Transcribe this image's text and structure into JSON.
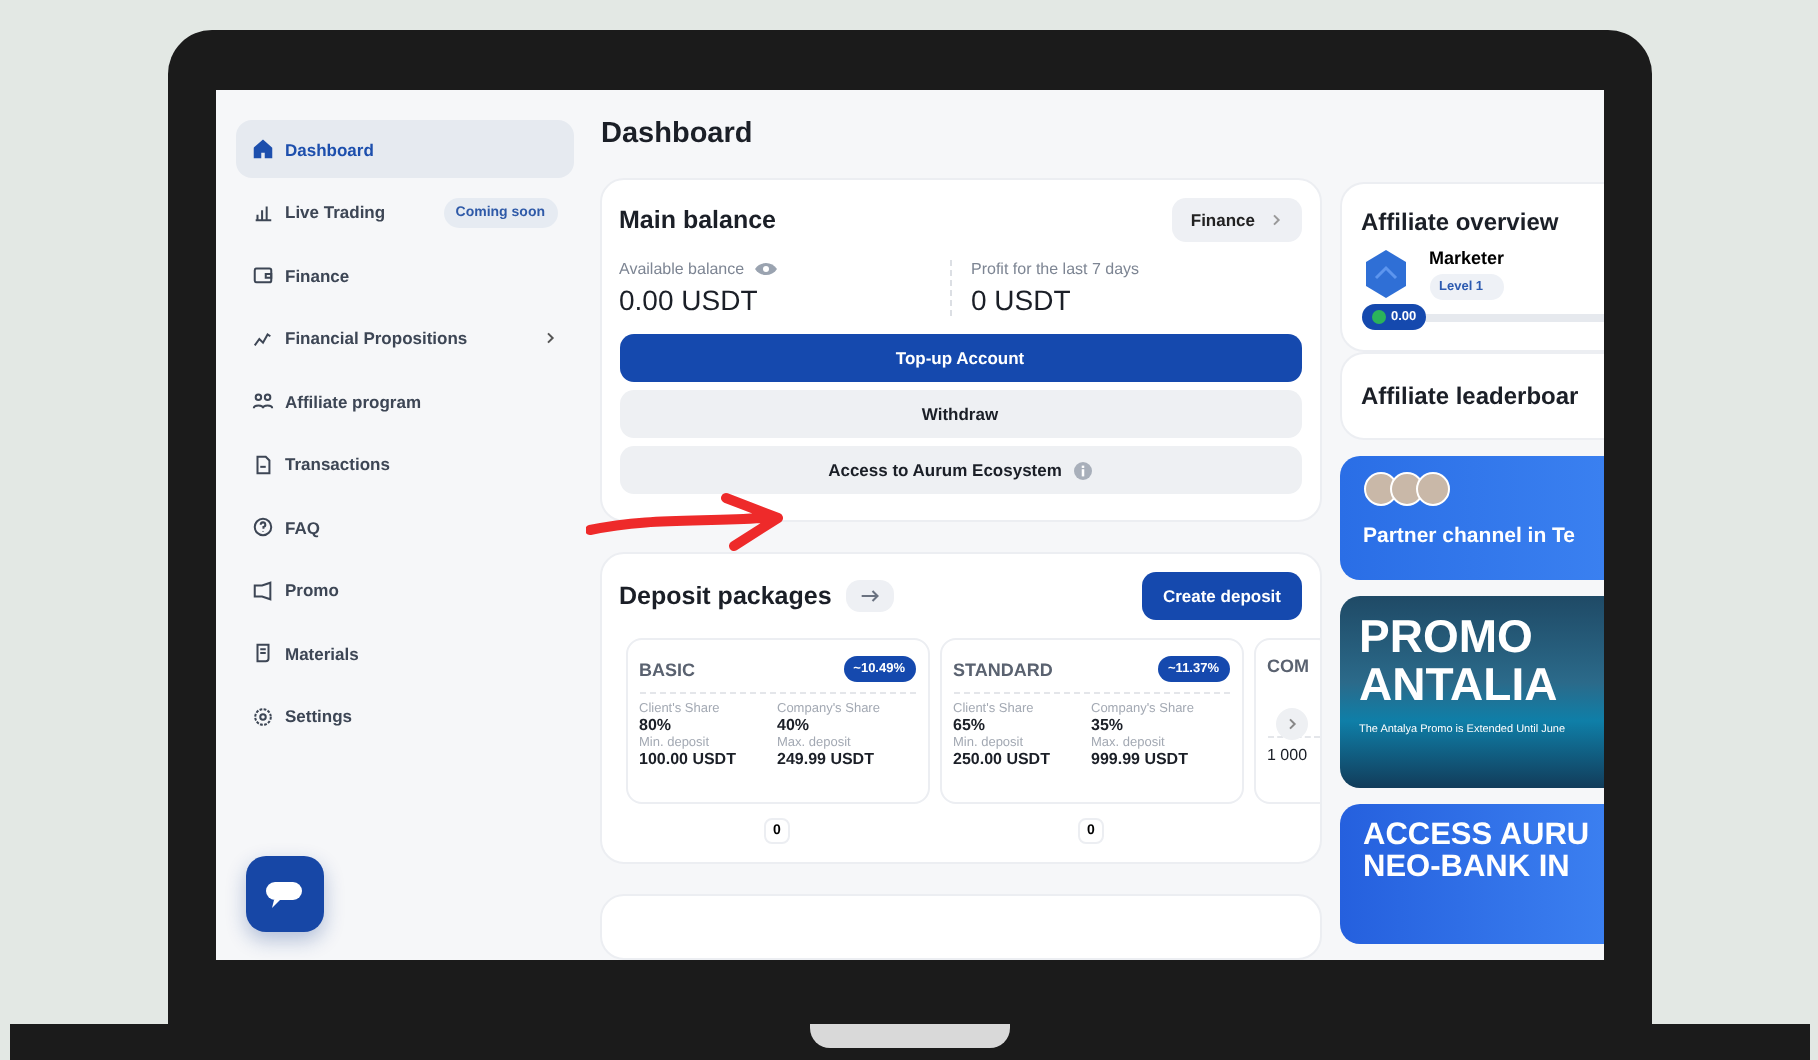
{
  "page": {
    "title": "Dashboard"
  },
  "sidebar": {
    "items": [
      {
        "label": "Dashboard",
        "selected": true,
        "submenu": false
      },
      {
        "label": "Live Trading",
        "selected": false,
        "submenu": false,
        "badge": "Coming soon"
      },
      {
        "label": "Finance",
        "selected": false,
        "submenu": false
      },
      {
        "label": "Financial Propositions",
        "selected": false,
        "submenu": true
      },
      {
        "label": "Affiliate program",
        "selected": false,
        "submenu": false
      },
      {
        "label": "Transactions",
        "selected": false,
        "submenu": false
      },
      {
        "label": "FAQ",
        "selected": false,
        "submenu": false
      },
      {
        "label": "Promo",
        "selected": false,
        "submenu": false
      },
      {
        "label": "Materials",
        "selected": false,
        "submenu": false
      },
      {
        "label": "Settings",
        "selected": false,
        "submenu": false
      }
    ]
  },
  "main_balance": {
    "title": "Main balance",
    "link": "Finance",
    "stats": [
      {
        "label": "Available balance",
        "value": "0.00 USDT",
        "hideable": true
      },
      {
        "label": "Profit for the last 7 days",
        "value": "0 USDT",
        "hideable": false
      }
    ],
    "buttons": [
      {
        "label": "Top-up Account",
        "kind": "primary",
        "info": false
      },
      {
        "label": "Withdraw",
        "kind": "secondary",
        "info": false
      },
      {
        "label": "Access to Aurum Ecosystem",
        "kind": "secondary",
        "info": true
      }
    ]
  },
  "deposit_packages": {
    "title": "Deposit packages",
    "create_button": "Create deposit",
    "packages": [
      {
        "name": "BASIC",
        "rate": "~10.49%",
        "count": "0",
        "fields": [
          {
            "label": "Client's Share",
            "value": "80%"
          },
          {
            "label": "Company's Share",
            "value": "40%"
          },
          {
            "label": "Min. deposit",
            "value": "100.00 USDT"
          },
          {
            "label": "Max. deposit",
            "value": "249.99 USDT"
          }
        ]
      },
      {
        "name": "STANDARD",
        "rate": "~11.37%",
        "count": "0",
        "fields": [
          {
            "label": "Client's Share",
            "value": "65%"
          },
          {
            "label": "Company's Share",
            "value": "35%"
          },
          {
            "label": "Min. deposit",
            "value": "250.00 USDT"
          },
          {
            "label": "Max. deposit",
            "value": "999.99 USDT"
          }
        ]
      },
      {
        "name": "COM",
        "fields": [
          {
            "value": "1 000"
          }
        ]
      }
    ]
  },
  "affiliate_overview": {
    "title": "Affiliate overview",
    "rank": "Marketer",
    "level_badge": "Level 1",
    "points": "0.00",
    "level": 0
  },
  "affiliate_leaderboard": {
    "title": "Affiliate leaderboar"
  },
  "banners": [
    {
      "kind": "partner",
      "lines": [
        "Partner channel in Te"
      ]
    },
    {
      "kind": "promo",
      "lines": [
        "PROMO",
        "ANTALIA"
      ],
      "caption": "The Antalya Promo is Extended Until June"
    },
    {
      "kind": "access",
      "lines": [
        "ACCESS AURU",
        "NEO-BANK IN"
      ]
    }
  ]
}
